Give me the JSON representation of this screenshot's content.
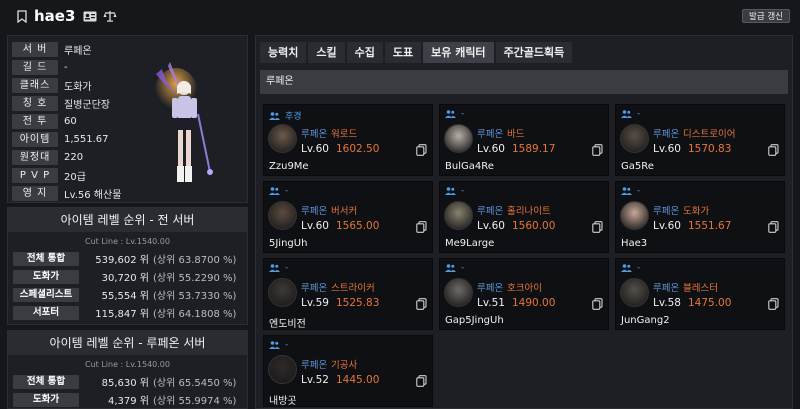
{
  "header": {
    "character_name": "hae3",
    "refresh_label": "발급 갱신",
    "icons": [
      "bookmark-icon",
      "id-card-icon",
      "scale-icon"
    ]
  },
  "profile": {
    "rows": [
      {
        "label": "서 버",
        "value": "루페온"
      },
      {
        "label": "길 드",
        "value": "-"
      },
      {
        "label": "클래스",
        "value": "도화가"
      },
      {
        "label": "칭 호",
        "value": "질병군단장"
      },
      {
        "label": "전 투",
        "value": "60"
      },
      {
        "label": "아이템",
        "value": "1,551.67"
      },
      {
        "label": "원정대",
        "value": "220"
      },
      {
        "label": "P V P",
        "value": "20급"
      },
      {
        "label": "영 지",
        "value": "Lv.56 해산물"
      }
    ]
  },
  "rank_all": {
    "title": "아이템 레벨 순위 - 전 서버",
    "cutline": "Cut Line : Lv.1540.00",
    "rows": [
      {
        "label": "전체 통합",
        "rank": "539,602 위",
        "pct": "(상위 63.8700 %)"
      },
      {
        "label": "도화가",
        "rank": "30,720 위",
        "pct": "(상위 55.2290 %)"
      },
      {
        "label": "스페셜리스트",
        "rank": "55,554 위",
        "pct": "(상위 53.7330 %)"
      },
      {
        "label": "서포터",
        "rank": "115,847 위",
        "pct": "(상위 64.1808 %)"
      }
    ]
  },
  "rank_server": {
    "title": "아이템 레벨 순위 - 루페온 서버",
    "cutline": "Cut Line : Lv.1540.00",
    "rows": [
      {
        "label": "전체 통합",
        "rank": "85,630 위",
        "pct": "(상위 65.5450 %)"
      },
      {
        "label": "도화가",
        "rank": "4,379 위",
        "pct": "(상위 55.9974 %)"
      }
    ]
  },
  "tabs": [
    {
      "label": "능력치",
      "active": false
    },
    {
      "label": "스킬",
      "active": false
    },
    {
      "label": "수집",
      "active": false
    },
    {
      "label": "도표",
      "active": false
    },
    {
      "label": "보유 캐릭터",
      "active": true
    },
    {
      "label": "주간골드획득",
      "active": false
    }
  ],
  "server_bar": "루페온",
  "characters": [
    {
      "tag": "후경",
      "server": "루페온",
      "class": "워로드",
      "lv": "Lv.60",
      "ilv": "1602.50",
      "name": "Zzu9Me",
      "avatar_color": "#6b5a4a"
    },
    {
      "tag": "-",
      "server": "루페온",
      "class": "바드",
      "lv": "Lv.60",
      "ilv": "1589.17",
      "name": "BulGa4Re",
      "avatar_color": "#b8b0a8"
    },
    {
      "tag": "-",
      "server": "루페온",
      "class": "디스트로이어",
      "lv": "Lv.60",
      "ilv": "1570.83",
      "name": "Ga5Re",
      "avatar_color": "#5a4e44"
    },
    {
      "tag": "-",
      "server": "루페온",
      "class": "버서커",
      "lv": "Lv.60",
      "ilv": "1565.00",
      "name": "5JingUh",
      "avatar_color": "#5c4c3f"
    },
    {
      "tag": "-",
      "server": "루페온",
      "class": "홀리나이트",
      "lv": "Lv.60",
      "ilv": "1560.00",
      "name": "Me9Large",
      "avatar_color": "#8a8270"
    },
    {
      "tag": "-",
      "server": "루페온",
      "class": "도화가",
      "lv": "Lv.60",
      "ilv": "1551.67",
      "name": "Hae3",
      "avatar_color": "#c9a89a"
    },
    {
      "tag": "-",
      "server": "루페온",
      "class": "스트라이커",
      "lv": "Lv.59",
      "ilv": "1525.83",
      "name": "엔도비전",
      "avatar_color": "#3d3935"
    },
    {
      "tag": "-",
      "server": "루페온",
      "class": "호크아이",
      "lv": "Lv.51",
      "ilv": "1490.00",
      "name": "Gap5JingUh",
      "avatar_color": "#6e6a66"
    },
    {
      "tag": "-",
      "server": "루페온",
      "class": "블레스터",
      "lv": "Lv.58",
      "ilv": "1475.00",
      "name": "JunGang2",
      "avatar_color": "#55504a"
    },
    {
      "tag": "-",
      "server": "루페온",
      "class": "기공사",
      "lv": "Lv.52",
      "ilv": "1445.00",
      "name": "내방곳",
      "avatar_color": "#2e2a28"
    }
  ],
  "colors": {
    "background": "#16171b",
    "panel": "#1d1f24",
    "label_bg": "#3a3c42",
    "server_blue": "#5e93d6",
    "accent_orange": "#e5753a"
  }
}
